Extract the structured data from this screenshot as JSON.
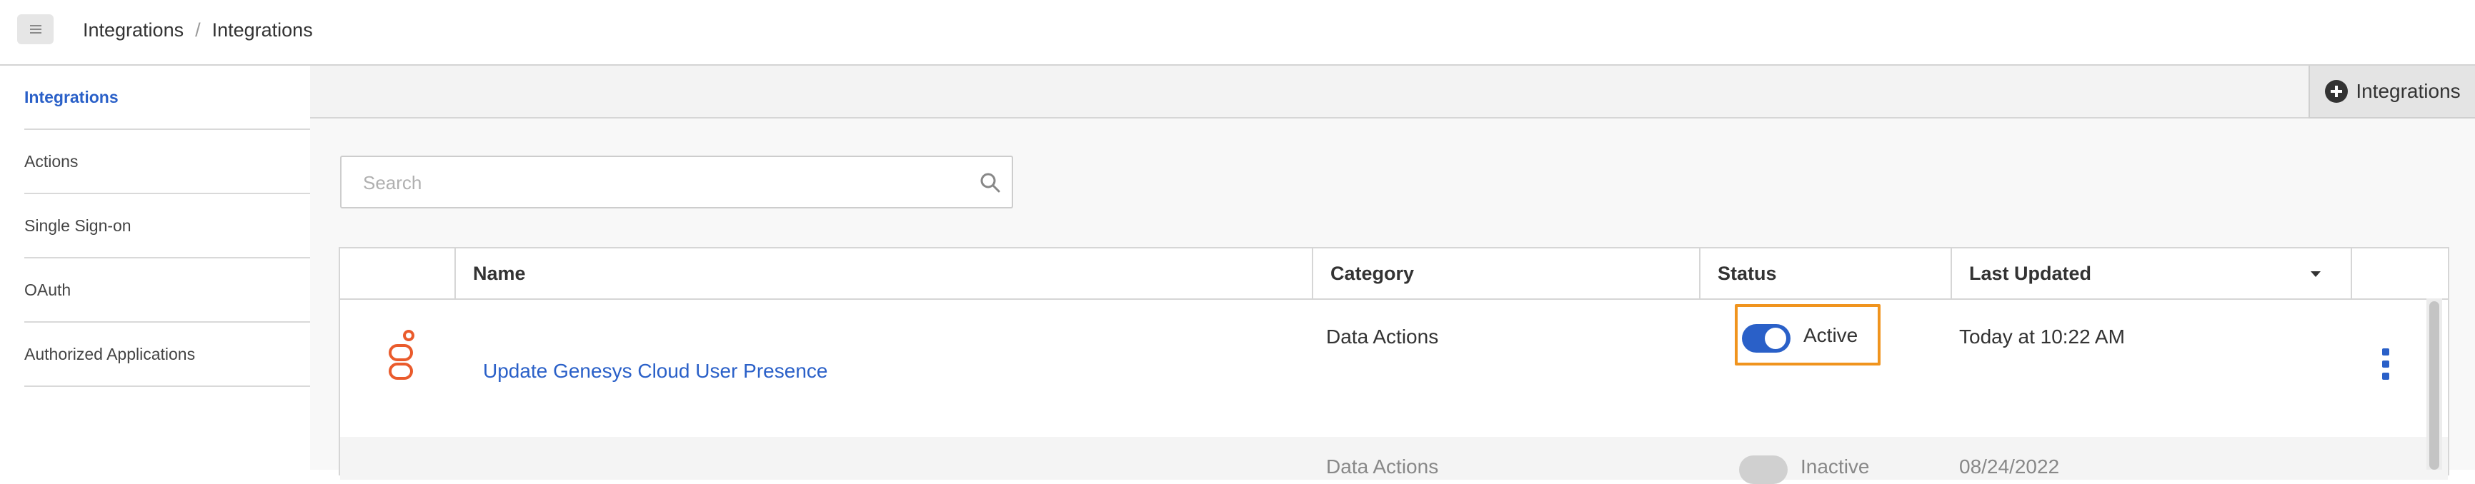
{
  "header": {
    "breadcrumb": [
      "Integrations",
      "Integrations"
    ],
    "separator": "/"
  },
  "sidebar": {
    "items": [
      {
        "label": "Integrations",
        "active": true
      },
      {
        "label": "Actions",
        "active": false
      },
      {
        "label": "Single Sign-on",
        "active": false
      },
      {
        "label": "OAuth",
        "active": false
      },
      {
        "label": "Authorized Applications",
        "active": false
      }
    ]
  },
  "toolbar": {
    "add_label": "Integrations",
    "add_icon": "plus-circle-icon"
  },
  "search": {
    "placeholder": "Search",
    "value": ""
  },
  "table": {
    "columns": [
      "Name",
      "Category",
      "Status",
      "Last Updated"
    ],
    "sort_column": "Last Updated",
    "rows": [
      {
        "name": "Update Genesys Cloud User Presence",
        "category": "Data Actions",
        "status": "Active",
        "active": true,
        "last_updated": "Today at 10:22 AM",
        "logo": "genesys-logo-icon"
      },
      {
        "name": "",
        "category": "Data Actions",
        "status": "Inactive",
        "active": false,
        "last_updated": "08/24/2022"
      }
    ]
  },
  "colors": {
    "accent": "#2a60c8",
    "highlight": "#f0941e",
    "logo": "#ea5b2c"
  }
}
